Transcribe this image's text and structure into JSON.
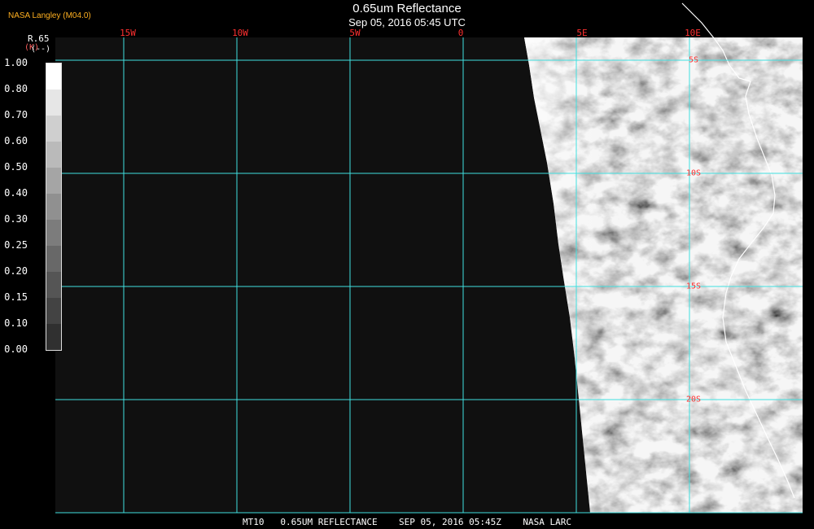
{
  "header": {
    "title": "0.65um Reflectance",
    "subtitle": "Sep 05, 2016 05:45 UTC",
    "agency": "NASA Langley (M04.0)"
  },
  "colorbar": {
    "channel": "R.65",
    "unit": "(K)",
    "unit_alt": "(--)",
    "ticks": [
      "1.00",
      "0.80",
      "0.70",
      "0.60",
      "0.50",
      "0.40",
      "0.30",
      "0.25",
      "0.20",
      "0.15",
      "0.10",
      "0.00"
    ],
    "colors": [
      "#ffffff",
      "#e6e6e6",
      "#cfcfcf",
      "#bababa",
      "#a5a5a5",
      "#909090",
      "#7c7c7c",
      "#686868",
      "#555555",
      "#434343",
      "#303030"
    ]
  },
  "grid": {
    "longitudes": [
      "15W",
      "10W",
      "5W",
      "0",
      "5E",
      "10E"
    ],
    "latitudes": [
      "5S",
      "10S",
      "15S",
      "20S"
    ],
    "color": "#40e0e0"
  },
  "footer": "MT10   0.65UM REFLECTANCE    SEP 05, 2016 05:45Z    NASA LARC"
}
